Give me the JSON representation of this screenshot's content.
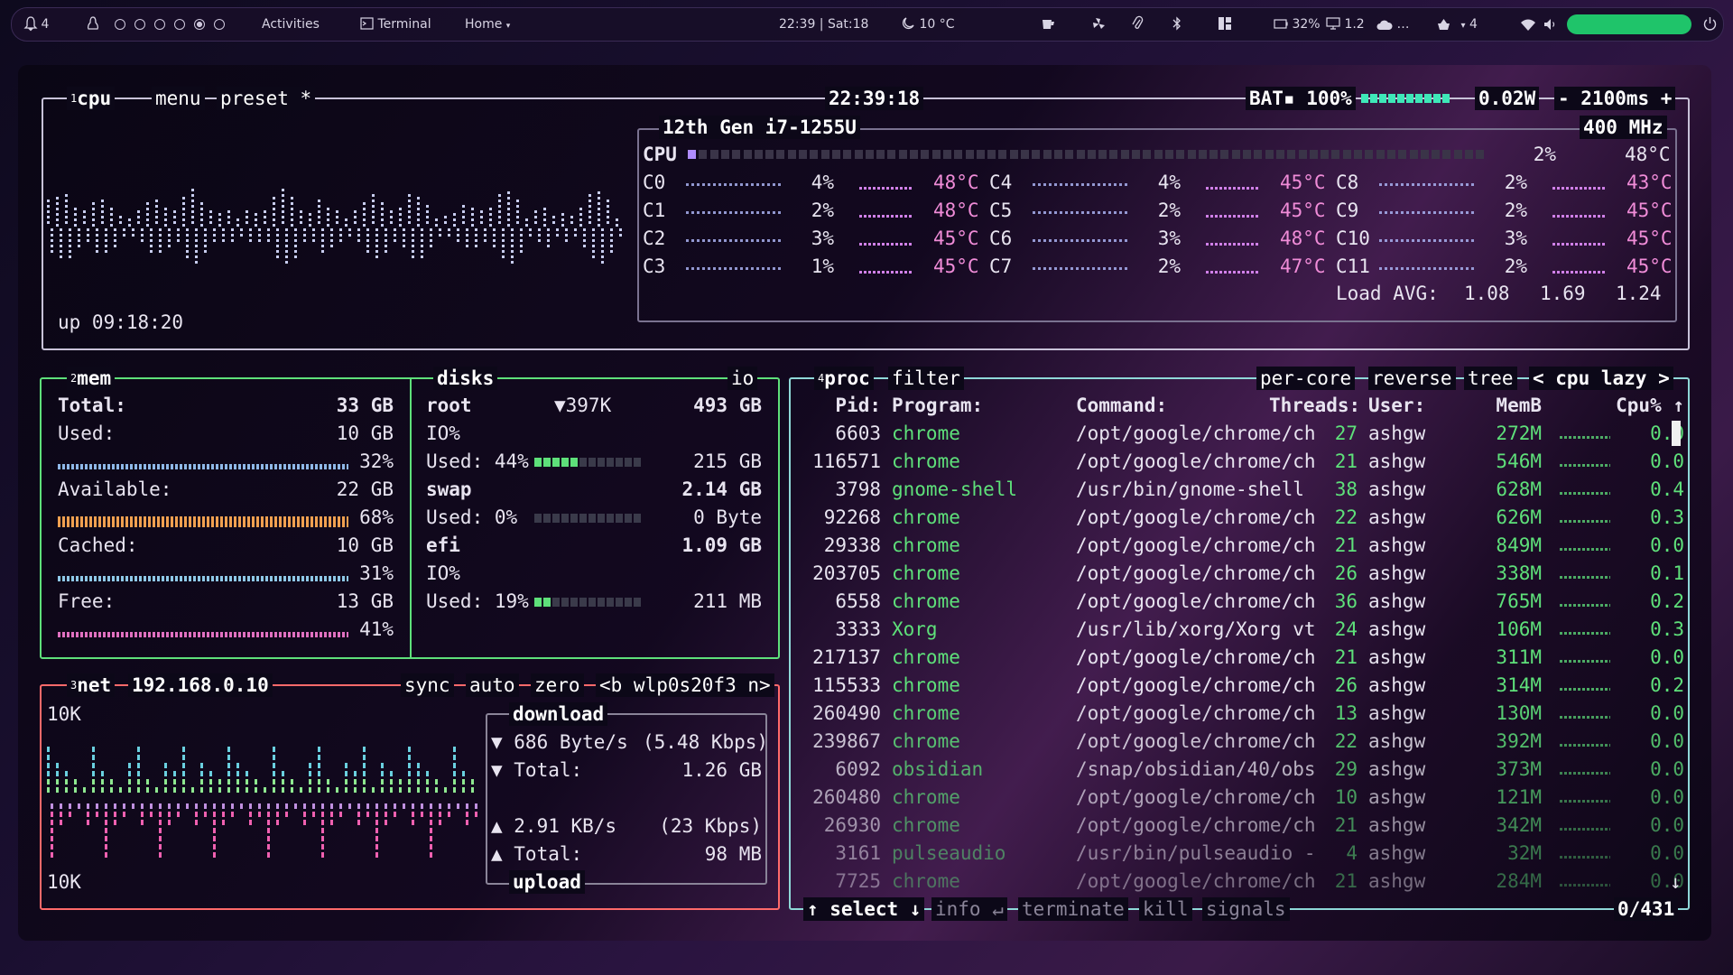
{
  "topbar": {
    "notif_count": "4",
    "activities": "Activities",
    "terminal": "Terminal",
    "home": "Home",
    "datetime": "22:39 | Sat:18",
    "weather": "10 °C",
    "battery": "32%",
    "monitor": "1.2",
    "cloud": "…",
    "updates": "4"
  },
  "cpu": {
    "num": "1",
    "label": "cpu",
    "menu": "menu",
    "preset": "preset *",
    "clock": "22:39:18",
    "bat": "BAT▪ 100%",
    "bat_level": 100,
    "power": "0.02W",
    "interval": "- 2100ms +",
    "model": "12th Gen i7-1255U",
    "freq": "400 MHz",
    "total": {
      "label": "CPU",
      "pct": "2%",
      "temp": "48°C"
    },
    "cores": [
      {
        "name": "C0",
        "pct": "4%",
        "temp": "48°C"
      },
      {
        "name": "C1",
        "pct": "2%",
        "temp": "48°C"
      },
      {
        "name": "C2",
        "pct": "3%",
        "temp": "45°C"
      },
      {
        "name": "C3",
        "pct": "1%",
        "temp": "45°C"
      },
      {
        "name": "C4",
        "pct": "4%",
        "temp": "45°C"
      },
      {
        "name": "C5",
        "pct": "2%",
        "temp": "45°C"
      },
      {
        "name": "C6",
        "pct": "3%",
        "temp": "48°C"
      },
      {
        "name": "C7",
        "pct": "2%",
        "temp": "47°C"
      },
      {
        "name": "C8",
        "pct": "2%",
        "temp": "43°C"
      },
      {
        "name": "C9",
        "pct": "2%",
        "temp": "45°C"
      },
      {
        "name": "C10",
        "pct": "3%",
        "temp": "45°C"
      },
      {
        "name": "C11",
        "pct": "2%",
        "temp": "45°C"
      }
    ],
    "load_label": "Load AVG:",
    "load": [
      "1.08",
      "1.69",
      "1.24"
    ],
    "uptime": "up 09:18:20"
  },
  "mem": {
    "num": "2",
    "label": "mem",
    "total_label": "Total:",
    "total": "33 GB",
    "used_label": "Used:",
    "used": "10 GB",
    "used_pct": "32%",
    "avail_label": "Available:",
    "avail": "22 GB",
    "avail_pct": "68%",
    "cached_label": "Cached:",
    "cached": "10 GB",
    "cached_pct": "31%",
    "free_label": "Free:",
    "free": "13 GB",
    "free_pct": "41%"
  },
  "disks": {
    "label": "disks",
    "io_label": "io",
    "root": {
      "name": "root",
      "io": "▼397K",
      "size": "493 GB",
      "io_label": "IO%",
      "used": "Used: 44%",
      "used_val": "215 GB",
      "pct": 44
    },
    "swap": {
      "name": "swap",
      "size": "2.14 GB",
      "used": "Used:  0%",
      "used_val": "0 Byte",
      "pct": 0
    },
    "efi": {
      "name": "efi",
      "size": "1.09 GB",
      "io_label": "IO%",
      "used": "Used: 19%",
      "used_val": "211 MB",
      "pct": 19
    }
  },
  "net": {
    "num": "3",
    "label": "net",
    "ip": "192.168.0.10",
    "sync": "sync",
    "auto": "auto",
    "zero": "zero",
    "iface": "<b wlp0s20f3 n>",
    "scale_top": "10K",
    "scale_bot": "10K",
    "download_label": "download",
    "dl_rate": "▼ 686 Byte/s",
    "dl_kbps": "(5.48 Kbps)",
    "dl_total_label": "▼ Total:",
    "dl_total": "1.26 GB",
    "ul_rate": "▲ 2.91 KB/s",
    "ul_kbps": "(23 Kbps)",
    "ul_total_label": "▲ Total:",
    "ul_total": "98 MB",
    "upload_label": "upload"
  },
  "proc": {
    "num": "4",
    "label": "proc",
    "filter": "filter",
    "per_core": "per-core",
    "reverse": "reverse",
    "tree": "tree",
    "sort": "< cpu lazy >",
    "headers": {
      "pid": "Pid:",
      "program": "Program:",
      "command": "Command:",
      "threads": "Threads:",
      "user": "User:",
      "mem": "MemB",
      "cpu": "Cpu% ↑"
    },
    "rows": [
      {
        "pid": "6603",
        "program": "chrome",
        "command": "/opt/google/chrome/ch",
        "threads": "27",
        "user": "ashgw",
        "mem": "272M",
        "cpu": "0.0"
      },
      {
        "pid": "116571",
        "program": "chrome",
        "command": "/opt/google/chrome/ch",
        "threads": "21",
        "user": "ashgw",
        "mem": "546M",
        "cpu": "0.0"
      },
      {
        "pid": "3798",
        "program": "gnome-shell",
        "command": "/usr/bin/gnome-shell",
        "threads": "38",
        "user": "ashgw",
        "mem": "628M",
        "cpu": "0.4"
      },
      {
        "pid": "92268",
        "program": "chrome",
        "command": "/opt/google/chrome/ch",
        "threads": "22",
        "user": "ashgw",
        "mem": "626M",
        "cpu": "0.3"
      },
      {
        "pid": "29338",
        "program": "chrome",
        "command": "/opt/google/chrome/ch",
        "threads": "21",
        "user": "ashgw",
        "mem": "849M",
        "cpu": "0.0"
      },
      {
        "pid": "203705",
        "program": "chrome",
        "command": "/opt/google/chrome/ch",
        "threads": "26",
        "user": "ashgw",
        "mem": "338M",
        "cpu": "0.1"
      },
      {
        "pid": "6558",
        "program": "chrome",
        "command": "/opt/google/chrome/ch",
        "threads": "36",
        "user": "ashgw",
        "mem": "765M",
        "cpu": "0.2"
      },
      {
        "pid": "3333",
        "program": "Xorg",
        "command": "/usr/lib/xorg/Xorg vt",
        "threads": "24",
        "user": "ashgw",
        "mem": "106M",
        "cpu": "0.3"
      },
      {
        "pid": "217137",
        "program": "chrome",
        "command": "/opt/google/chrome/ch",
        "threads": "21",
        "user": "ashgw",
        "mem": "311M",
        "cpu": "0.0"
      },
      {
        "pid": "115533",
        "program": "chrome",
        "command": "/opt/google/chrome/ch",
        "threads": "26",
        "user": "ashgw",
        "mem": "314M",
        "cpu": "0.2"
      },
      {
        "pid": "260490",
        "program": "chrome",
        "command": "/opt/google/chrome/ch",
        "threads": "13",
        "user": "ashgw",
        "mem": "130M",
        "cpu": "0.0"
      },
      {
        "pid": "239867",
        "program": "chrome",
        "command": "/opt/google/chrome/ch",
        "threads": "22",
        "user": "ashgw",
        "mem": "392M",
        "cpu": "0.0"
      },
      {
        "pid": "6092",
        "program": "obsidian",
        "command": "/snap/obsidian/40/obs",
        "threads": "29",
        "user": "ashgw",
        "mem": "373M",
        "cpu": "0.0"
      },
      {
        "pid": "260480",
        "program": "chrome",
        "command": "/opt/google/chrome/ch",
        "threads": "10",
        "user": "ashgw",
        "mem": "121M",
        "cpu": "0.0"
      },
      {
        "pid": "26930",
        "program": "chrome",
        "command": "/opt/google/chrome/ch",
        "threads": "21",
        "user": "ashgw",
        "mem": "342M",
        "cpu": "0.0"
      },
      {
        "pid": "3161",
        "program": "pulseaudio",
        "command": "/usr/bin/pulseaudio -",
        "threads": "4",
        "user": "ashgw",
        "mem": "32M",
        "cpu": "0.0"
      },
      {
        "pid": "7725",
        "program": "chrome",
        "command": "/opt/google/chrome/ch",
        "threads": "21",
        "user": "ashgw",
        "mem": "284M",
        "cpu": "0.0"
      }
    ],
    "footer": {
      "select": "↑ select ↓",
      "info": "info ↵",
      "terminate": "terminate",
      "kill": "kill",
      "signals": "signals",
      "count": "0/431"
    }
  },
  "colors": {
    "cpu": "#c8c2d8",
    "mem": "#5ee07a",
    "net": "#ff6a6a",
    "proc": "#8fd8d8",
    "accent": "#9af58a",
    "bar_cpu": "#8a6cff",
    "pill": "#1fc46a"
  }
}
